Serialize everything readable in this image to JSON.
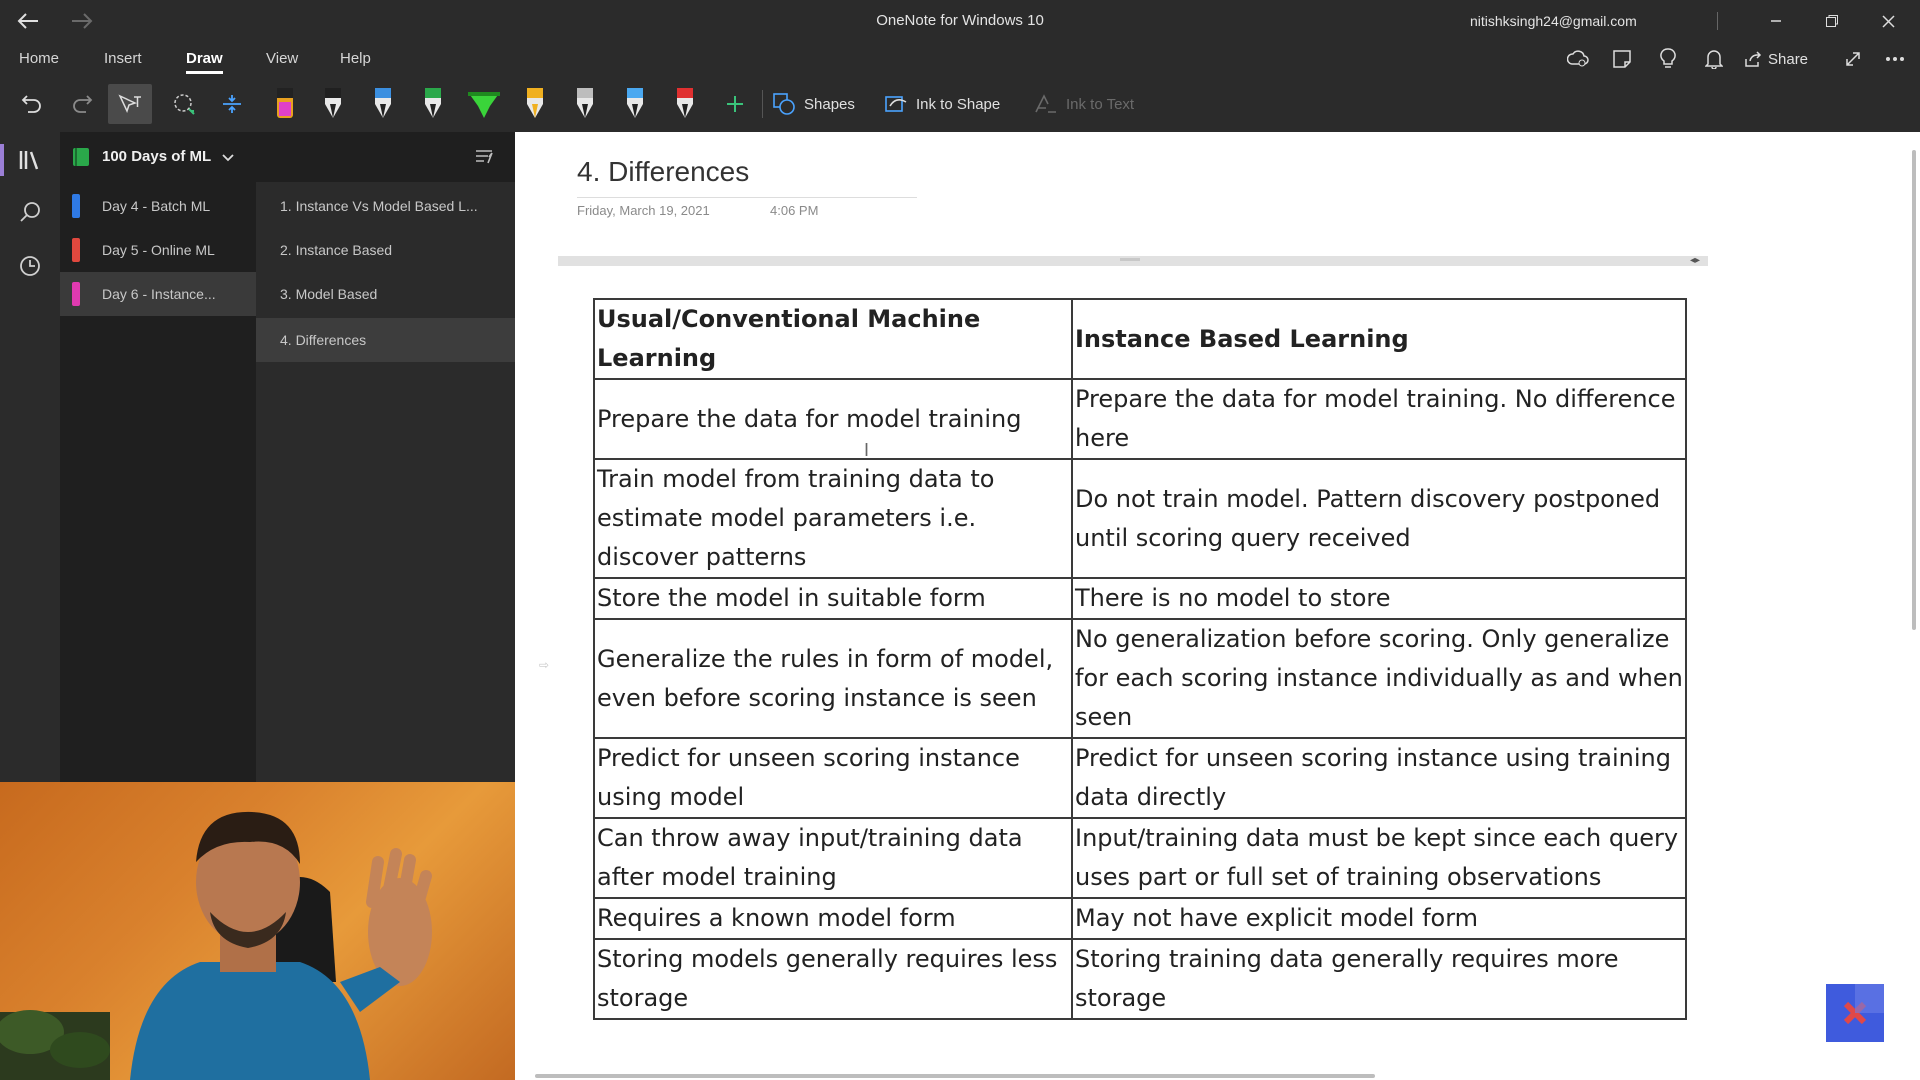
{
  "window": {
    "title": "OneNote for Windows 10",
    "account": "nitishksingh24@gmail.com"
  },
  "menu": {
    "items": [
      "Home",
      "Insert",
      "Draw",
      "View",
      "Help"
    ],
    "active": "Draw",
    "share_label": "Share"
  },
  "toolbar": {
    "shapes_label": "Shapes",
    "ink_to_shape_label": "Ink to Shape",
    "ink_to_text_label": "Ink to Text",
    "pens": [
      {
        "color": "#e040c8"
      },
      {
        "color": "#202020"
      },
      {
        "color": "#3b8fe0"
      },
      {
        "color": "#2aa84a"
      },
      {
        "color": "#3ad43a"
      },
      {
        "color": "#f0b020"
      },
      {
        "color": "#e8e8e8"
      },
      {
        "color": "#4aa8f0"
      },
      {
        "color": "#e03030"
      }
    ]
  },
  "notebook": {
    "name": "100 Days of ML",
    "sections": [
      {
        "label": "Day 4 - Batch ML",
        "color": "#2f7ae5"
      },
      {
        "label": "Day 5 - Online ML",
        "color": "#e0483e"
      },
      {
        "label": "Day 6 - Instance...",
        "color": "#e03ab0"
      }
    ],
    "selected_section": 2,
    "pages": [
      {
        "label": "1. Instance Vs Model Based L..."
      },
      {
        "label": "2. Instance Based"
      },
      {
        "label": "3. Model Based"
      },
      {
        "label": "4. Differences"
      }
    ],
    "selected_page": 3
  },
  "page": {
    "title": "4. Differences",
    "date": "Friday, March 19, 2021",
    "time": "4:06 PM"
  },
  "table": {
    "headers": [
      "Usual/Conventional Machine Learning",
      "Instance Based Learning"
    ],
    "rows": [
      [
        "Prepare the data for model training",
        "Prepare the data for model training. No difference here"
      ],
      [
        "Train model from training data to estimate model parameters i.e. discover patterns",
        "Do not train model. Pattern discovery postponed until scoring query received"
      ],
      [
        "Store the model in suitable form",
        "There is no model to store"
      ],
      [
        "Generalize the rules in form of model, even before scoring instance is seen",
        "No generalization before scoring. Only generalize for each scoring instance individually as and when seen"
      ],
      [
        "Predict for unseen scoring instance using model",
        "Predict for unseen scoring instance using training data directly"
      ],
      [
        "Can throw away input/training data after model training",
        "Input/training data must be kept since each query uses part or full set of training observations"
      ],
      [
        "Requires a known model form",
        "May not have explicit model form"
      ],
      [
        "Storing models generally requires less storage",
        "Storing training data generally requires more storage"
      ]
    ]
  }
}
